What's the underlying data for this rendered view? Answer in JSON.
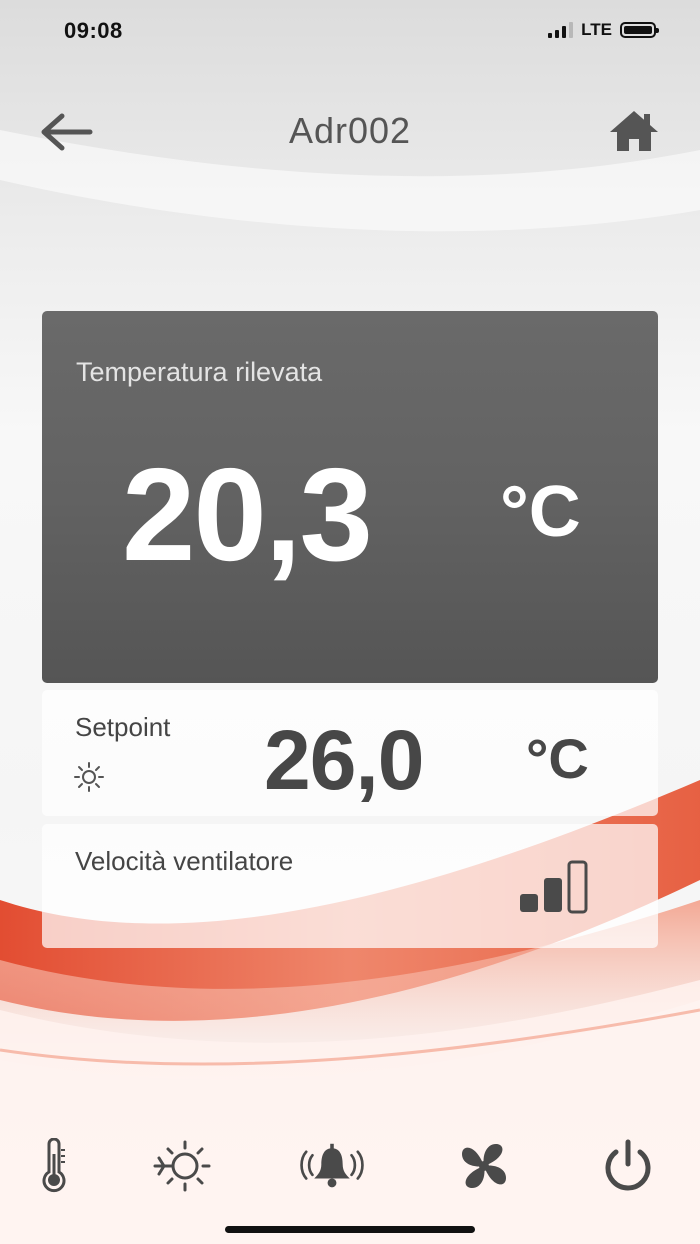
{
  "status_bar": {
    "time": "09:08",
    "network": "LTE",
    "signal_bars_active": 3,
    "signal_bars_total": 4,
    "battery_level": 1.0
  },
  "header": {
    "title": "Adr002",
    "back_icon": "arrow-left-icon",
    "home_icon": "home-icon"
  },
  "measured": {
    "label": "Temperatura rilevata",
    "value": "20,3",
    "unit": "°C"
  },
  "setpoint": {
    "label": "Setpoint",
    "value": "26,0",
    "unit": "°C",
    "mode_icon": "sun-icon"
  },
  "fan": {
    "label": "Velocità ventilatore",
    "level": 2,
    "max_level": 3,
    "icon": "fan-speed-bars-icon"
  },
  "toolbar": [
    {
      "icon": "thermometer-icon"
    },
    {
      "icon": "sun-snowflake-icon"
    },
    {
      "icon": "bell-alarm-icon"
    },
    {
      "icon": "fan-icon"
    },
    {
      "icon": "power-icon"
    }
  ],
  "colors": {
    "card_dark": "#626262",
    "text_dark": "#474747",
    "accent_red": "#e2482b"
  }
}
